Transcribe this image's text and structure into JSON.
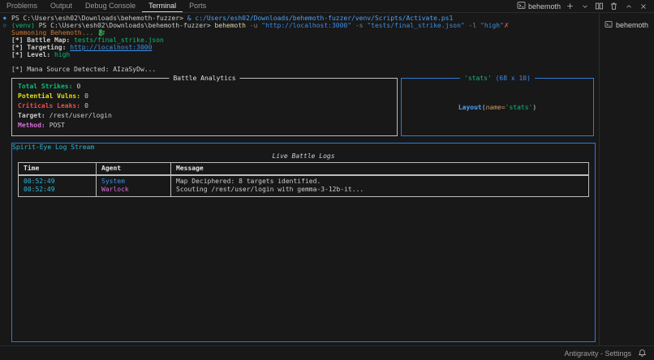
{
  "panel_tabs": {
    "items": [
      {
        "label": "Problems"
      },
      {
        "label": "Output"
      },
      {
        "label": "Debug Console"
      },
      {
        "label": "Terminal"
      },
      {
        "label": "Ports"
      }
    ],
    "active": "Terminal"
  },
  "terminal_controls": {
    "profile_name": "behemoth"
  },
  "terminal_list": {
    "items": [
      {
        "label": "behemoth"
      }
    ]
  },
  "status_bar": {
    "right_label": "Antigravity - Settings"
  },
  "terminal": {
    "line1": {
      "prompt": "PS C:\\Users\\esh02\\Downloads\\behemoth-fuzzer> ",
      "command": "& c:/Users/esh02/Downloads/behemoth-fuzzer/venv/Scripts/Activate.ps1"
    },
    "line2": {
      "venv": "(venv) ",
      "prompt": "PS C:\\Users\\esh02\\Downloads\\behemoth-fuzzer> ",
      "command": "behemoth",
      "flag_u": " -u ",
      "arg_url": "\"http://localhost:3000\"",
      "flag_s": " -s ",
      "arg_file": "\"tests/final_strike.json\"",
      "flag_l": " -l ",
      "arg_level": "\"high\"",
      "error_mark": "✗"
    },
    "line3": {
      "text": "Summoning Behemoth... ",
      "emoji": "🐉"
    },
    "line4": {
      "label": "[*] Battle Map: ",
      "value": "tests/final_strike.json"
    },
    "line5": {
      "label": "[*] Targeting: ",
      "value": "http://localhost:3000"
    },
    "line6": {
      "label": "[*] Level: ",
      "value": "high"
    },
    "line8": {
      "text": "[*] Mana Source Detected: AIzaSyDw..."
    }
  },
  "analytics_box": {
    "title": "Battle Analytics",
    "rows": [
      {
        "label": "Total Strikes:",
        "value": "0"
      },
      {
        "label": "Potential Vulns:",
        "value": "0"
      },
      {
        "label": "Criticals Leaks:",
        "value": "0"
      },
      {
        "label": "Target:",
        "value": "/rest/user/login"
      },
      {
        "label": "Method:",
        "value": "POST"
      }
    ]
  },
  "stats_box": {
    "title_name": "'stats'",
    "title_size": " (68 x 10)",
    "class_name": "Layout",
    "paren_open": "(",
    "attr_name": "name=",
    "attr_value": "'stats'",
    "paren_close": ")"
  },
  "log_box": {
    "title": "Spirit-Eye Log Stream",
    "subtitle": "Live Battle Logs",
    "table": {
      "headers": [
        "Time",
        "Agent",
        "Message"
      ],
      "rows": [
        {
          "time": "00:52:49",
          "agent": "System",
          "message": "Map Deciphered: 8 targets identified."
        },
        {
          "time": "00:52:49",
          "agent": "Warlock",
          "message": "Scouting /rest/user/login with gemma-3-12b-it..."
        }
      ]
    }
  },
  "colors": {
    "background": "#181818",
    "foreground": "#cccccc",
    "accent_blue": "#3b8eea",
    "cyan": "#29b8db",
    "green": "#0dbc79",
    "yellow": "#e2e210",
    "red": "#f14c4c",
    "magenta": "#d670d6",
    "orange": "#cd7832",
    "box_border_blue": "#2e7bd6",
    "box_border_gray": "#bdbdbd"
  }
}
